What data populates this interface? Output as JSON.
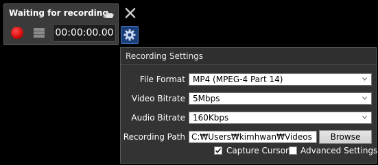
{
  "recorder": {
    "status": "Waiting for recording",
    "timer": "00:00:00.00",
    "icons": {
      "folder": "folder-open-icon",
      "record": "record-icon",
      "stop": "stop-icon",
      "close": "close-icon",
      "settings": "gear-icon"
    },
    "colors": {
      "record": "#d80f0f",
      "settings_bg": "#1b3f78"
    }
  },
  "settings": {
    "title": "Recording Settings",
    "file_format": {
      "label": "File Format",
      "value": "MP4 (MPEG-4 Part 14)"
    },
    "video_bitrate": {
      "label": "Video Bitrate",
      "value": "5Mbps"
    },
    "audio_bitrate": {
      "label": "Audio Bitrate",
      "value": "160Kbps"
    },
    "recording_path": {
      "label": "Recording Path",
      "value": "C:₩Users₩kimhwan₩Videos",
      "button": "Browse"
    },
    "capture_cursor": {
      "label": "Capture Cursor",
      "checked": true
    },
    "advanced_settings": {
      "label": "Advanced Settings",
      "checked": false
    }
  }
}
